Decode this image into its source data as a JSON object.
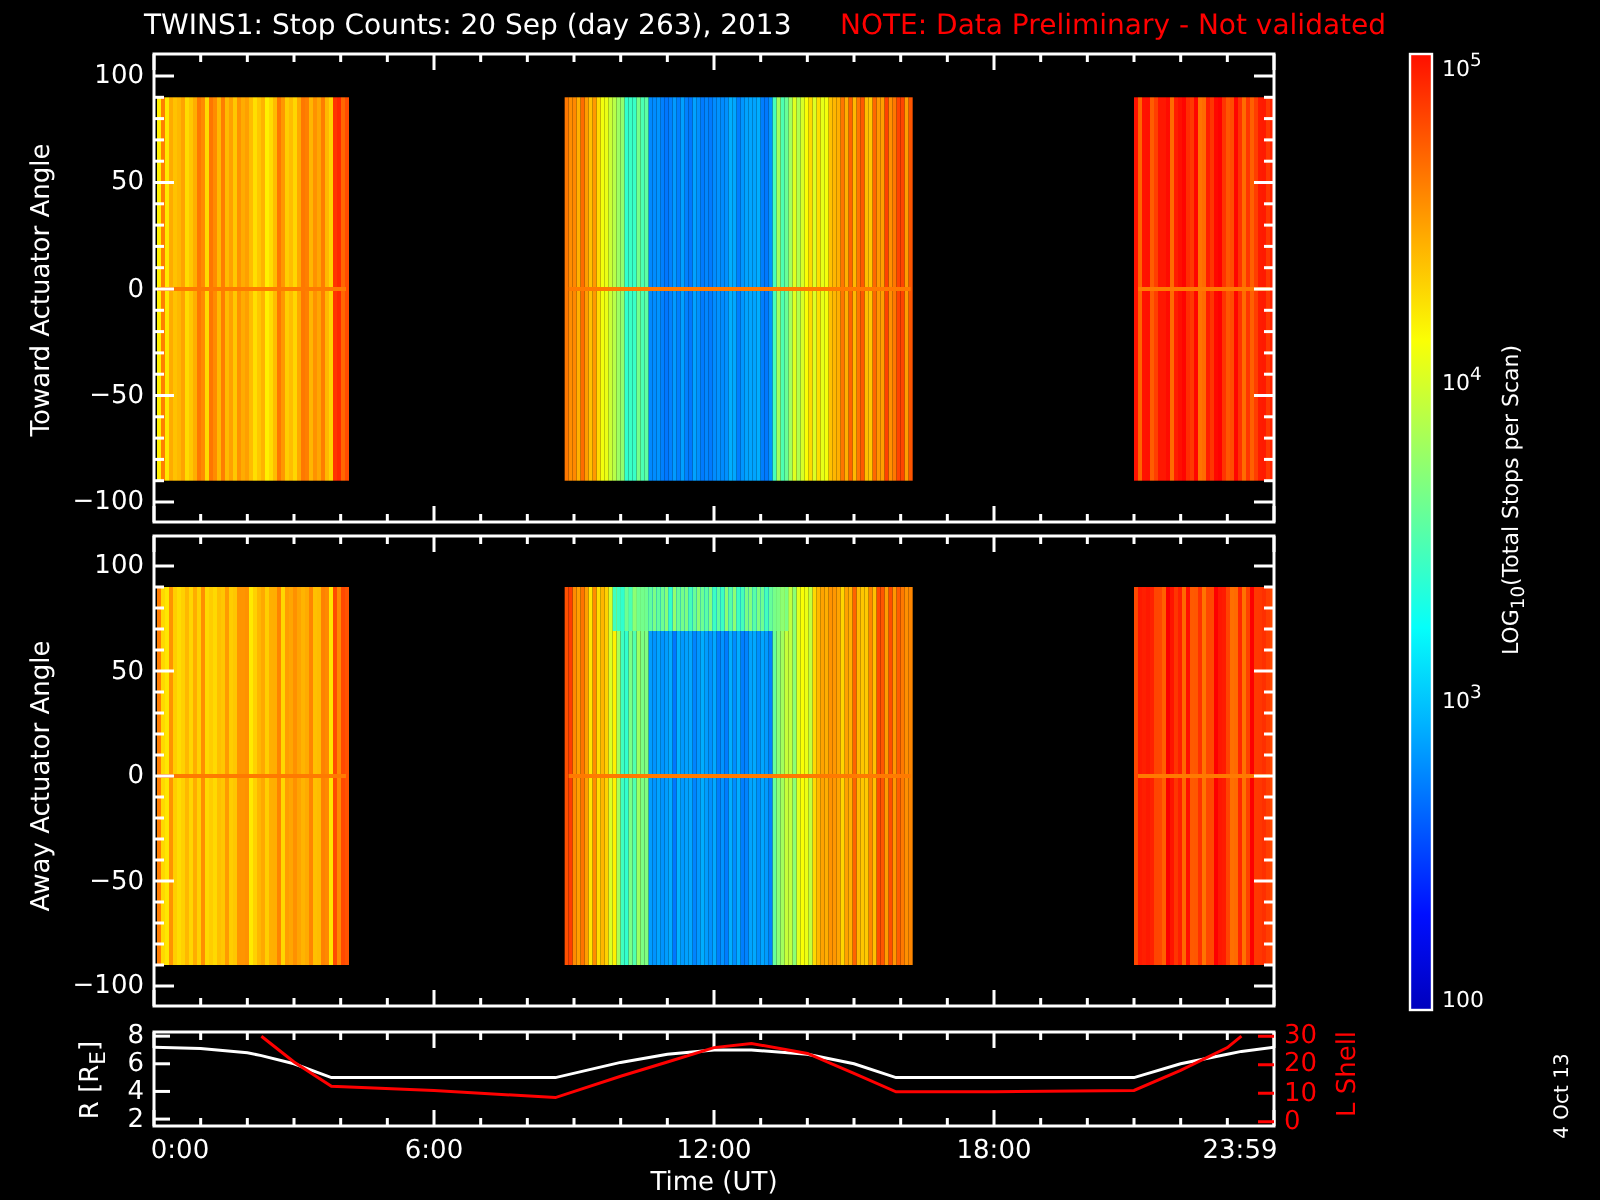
{
  "title": {
    "text": "TWINS1: Stop Counts: 20 Sep (day 263), 2013",
    "note": "NOTE: Data Preliminary - Not validated"
  },
  "panels": [
    {
      "ylabel": "Toward Actuator Angle",
      "yticks": [
        "100",
        "50",
        "0",
        "−50",
        "−100"
      ]
    },
    {
      "ylabel": "Away Actuator Angle",
      "yticks": [
        "100",
        "50",
        "0",
        "−50",
        "−100"
      ]
    }
  ],
  "colorbar": {
    "label": "LOG$_{10}$(Total Stops per Scan)",
    "ticks": [
      "10$^{5}$",
      "10$^{4}$",
      "10$^{3}$",
      "100"
    ]
  },
  "orbit": {
    "radius": {
      "chart_data": {
        "type": "line",
        "xlabel": "Time (UT)",
        "x": [
          0,
          1,
          2,
          2.3,
          3,
          3.8,
          6,
          8.6,
          10,
          11,
          12,
          12.8,
          14,
          15,
          15.9,
          18,
          21,
          22,
          23,
          23.3,
          24
        ],
        "xlim": [
          0,
          24
        ],
        "ylim": [
          1.5,
          8.3
        ],
        "xticks": [
          {
            "value": 0,
            "label": "0:00"
          },
          {
            "value": 6,
            "label": "6:00"
          },
          {
            "value": 12,
            "label": "12:00"
          },
          {
            "value": 18,
            "label": "18:00"
          },
          {
            "value": 23.983,
            "label": "23:59"
          }
        ],
        "yticks": [
          2,
          4,
          6,
          8
        ],
        "series": [
          {
            "name": "R [R$_{E}$]",
            "color": "#ffffff",
            "values": [
              7.2,
              7.1,
              6.8,
              6.6,
              6,
              5,
              5,
              5,
              6.1,
              6.7,
              7,
              7,
              6.7,
              6,
              5,
              5,
              5,
              6,
              6.7,
              6.9,
              7.2
            ]
          }
        ]
      }
    },
    "l_shell": {
      "chart_data": {
        "type": "line",
        "x": [
          2.3,
          3,
          3.8,
          6,
          8.6,
          10,
          11,
          12,
          12.8,
          14,
          15,
          15.9,
          18,
          21,
          22,
          23,
          23.3
        ],
        "xlim": [
          0,
          24
        ],
        "ylim": [
          -1.5,
          31.5
        ],
        "yticks": [
          0,
          10,
          20,
          30
        ],
        "series": [
          {
            "name": "L Shell",
            "color": "#ff0000",
            "values": [
              30,
              21,
              12.5,
              11,
              8.5,
              16,
              21,
              26,
              27.5,
              24,
              17,
              10.5,
              10.5,
              11,
              18,
              26,
              30
            ]
          }
        ]
      }
    }
  },
  "date_stamp": "4 Oct 13"
}
